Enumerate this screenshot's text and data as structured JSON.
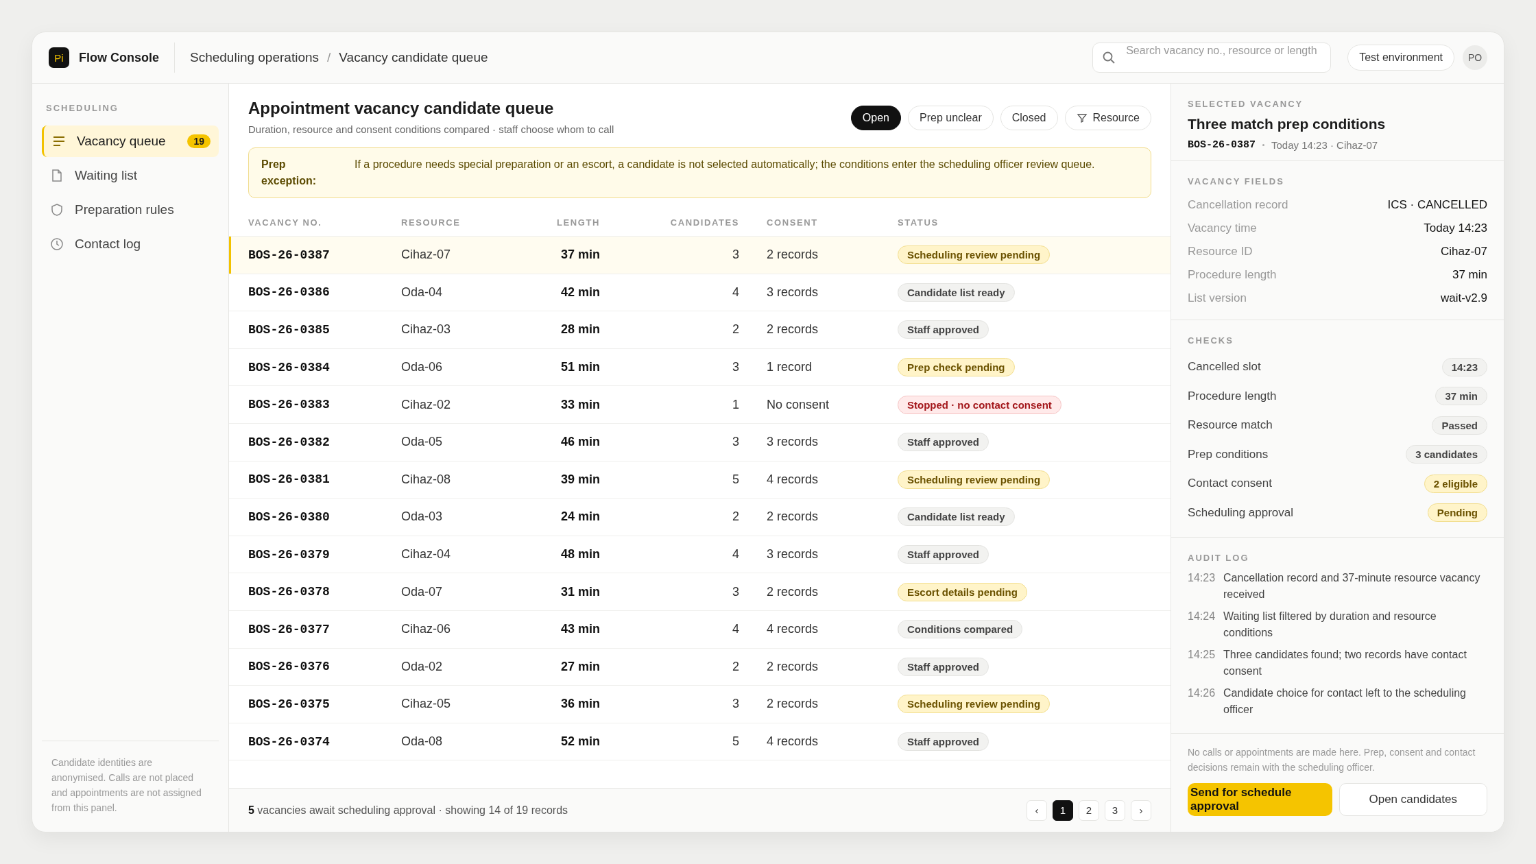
{
  "brand": {
    "logo": "Pi",
    "name": "Flow Console"
  },
  "breadcrumb": [
    "Scheduling operations",
    "/",
    "Vacancy candidate queue"
  ],
  "search": {
    "placeholder": "Search vacancy no., resource or length"
  },
  "environment": "Test environment",
  "avatar": "PO",
  "sidebar": {
    "heading": "SCHEDULING",
    "items": [
      {
        "label": "Vacancy queue",
        "badge": "19",
        "selected": true
      },
      {
        "label": "Waiting list",
        "selected": false
      },
      {
        "label": "Preparation rules",
        "selected": false
      },
      {
        "label": "Contact log",
        "selected": false
      }
    ],
    "note": "Candidate identities are anonymised. Calls are not placed and appointments are not assigned from this panel."
  },
  "main": {
    "title": "Appointment vacancy candidate queue",
    "subtitle": "Duration, resource and consent conditions compared · staff choose whom to call",
    "filters": [
      {
        "label": "Open",
        "selected": true,
        "kind": "chip"
      },
      {
        "label": "Prep unclear",
        "selected": false,
        "kind": "chip"
      },
      {
        "label": "Closed",
        "selected": false,
        "kind": "chip"
      },
      {
        "label": "Resource",
        "selected": false,
        "kind": "filter"
      }
    ],
    "banner": {
      "label": "Prep exception:",
      "text": "If a procedure needs special preparation or an escort, a candidate is not selected automatically; the conditions enter the scheduling officer review queue."
    },
    "table": {
      "columns": [
        "VACANCY NO.",
        "RESOURCE",
        "LENGTH",
        "CANDIDATES",
        "CONSENT",
        "STATUS"
      ],
      "rows": [
        {
          "id": "BOS-26-0387",
          "resource": "Cihaz-07",
          "length": "37 min",
          "candidates": "3",
          "consent": "2 records",
          "status": "Scheduling review pending",
          "kind": "warn",
          "selected": true
        },
        {
          "id": "BOS-26-0386",
          "resource": "Oda-04",
          "length": "42 min",
          "candidates": "4",
          "consent": "3 records",
          "status": "Candidate list ready",
          "kind": "neutral",
          "selected": false
        },
        {
          "id": "BOS-26-0385",
          "resource": "Cihaz-03",
          "length": "28 min",
          "candidates": "2",
          "consent": "2 records",
          "status": "Staff approved",
          "kind": "neutral",
          "selected": false
        },
        {
          "id": "BOS-26-0384",
          "resource": "Oda-06",
          "length": "51 min",
          "candidates": "3",
          "consent": "1 record",
          "status": "Prep check pending",
          "kind": "warn",
          "selected": false
        },
        {
          "id": "BOS-26-0383",
          "resource": "Cihaz-02",
          "length": "33 min",
          "candidates": "1",
          "consent": "No consent",
          "status": "Stopped · no contact consent",
          "kind": "danger",
          "selected": false
        },
        {
          "id": "BOS-26-0382",
          "resource": "Oda-05",
          "length": "46 min",
          "candidates": "3",
          "consent": "3 records",
          "status": "Staff approved",
          "kind": "neutral",
          "selected": false
        },
        {
          "id": "BOS-26-0381",
          "resource": "Cihaz-08",
          "length": "39 min",
          "candidates": "5",
          "consent": "4 records",
          "status": "Scheduling review pending",
          "kind": "warn",
          "selected": false
        },
        {
          "id": "BOS-26-0380",
          "resource": "Oda-03",
          "length": "24 min",
          "candidates": "2",
          "consent": "2 records",
          "status": "Candidate list ready",
          "kind": "neutral",
          "selected": false
        },
        {
          "id": "BOS-26-0379",
          "resource": "Cihaz-04",
          "length": "48 min",
          "candidates": "4",
          "consent": "3 records",
          "status": "Staff approved",
          "kind": "neutral",
          "selected": false
        },
        {
          "id": "BOS-26-0378",
          "resource": "Oda-07",
          "length": "31 min",
          "candidates": "3",
          "consent": "2 records",
          "status": "Escort details pending",
          "kind": "warn",
          "selected": false
        },
        {
          "id": "BOS-26-0377",
          "resource": "Cihaz-06",
          "length": "43 min",
          "candidates": "4",
          "consent": "4 records",
          "status": "Conditions compared",
          "kind": "neutral",
          "selected": false
        },
        {
          "id": "BOS-26-0376",
          "resource": "Oda-02",
          "length": "27 min",
          "candidates": "2",
          "consent": "2 records",
          "status": "Staff approved",
          "kind": "neutral",
          "selected": false
        },
        {
          "id": "BOS-26-0375",
          "resource": "Cihaz-05",
          "length": "36 min",
          "candidates": "3",
          "consent": "2 records",
          "status": "Scheduling review pending",
          "kind": "warn",
          "selected": false
        },
        {
          "id": "BOS-26-0374",
          "resource": "Oda-08",
          "length": "52 min",
          "candidates": "5",
          "consent": "4 records",
          "status": "Staff approved",
          "kind": "neutral",
          "selected": false
        }
      ]
    },
    "footer": "**5** vacancies await scheduling approval · showing 14 of 19 records",
    "pagination": {
      "prev": "‹",
      "next": "›",
      "pages": [
        {
          "label": "1",
          "selected": true
        },
        {
          "label": "2",
          "selected": false
        },
        {
          "label": "3",
          "selected": false
        }
      ]
    }
  },
  "detail": {
    "heading": "SELECTED VACANCY",
    "title": "Three match prep conditions",
    "id": "BOS-26-0387",
    "meta": "Today 14:23 · Cihaz-07",
    "fields_heading": "VACANCY FIELDS",
    "fields": [
      {
        "label": "Cancellation record",
        "value": "ICS · CANCELLED"
      },
      {
        "label": "Vacancy time",
        "value": "Today 14:23"
      },
      {
        "label": "Resource ID",
        "value": "Cihaz-07"
      },
      {
        "label": "Procedure length",
        "value": "37 min"
      },
      {
        "label": "List version",
        "value": "wait-v2.9"
      }
    ],
    "checks_heading": "CHECKS",
    "checks": [
      {
        "label": "Cancelled slot",
        "value": "14:23",
        "kind": "neutral"
      },
      {
        "label": "Procedure length",
        "value": "37 min",
        "kind": "neutral"
      },
      {
        "label": "Resource match",
        "value": "Passed",
        "kind": "neutral"
      },
      {
        "label": "Prep conditions",
        "value": "3 candidates",
        "kind": "neutral"
      },
      {
        "label": "Contact consent",
        "value": "2 eligible",
        "kind": "warn"
      },
      {
        "label": "Scheduling approval",
        "value": "Pending",
        "kind": "warn"
      }
    ],
    "log_heading": "AUDIT LOG",
    "log": [
      {
        "time": "14:23",
        "text": "Cancellation record and 37-minute resource vacancy received"
      },
      {
        "time": "14:24",
        "text": "Waiting list filtered by duration and resource conditions"
      },
      {
        "time": "14:25",
        "text": "Three candidates found; two records have contact consent"
      },
      {
        "time": "14:26",
        "text": "Candidate choice for contact left to the scheduling officer"
      }
    ],
    "note": "No calls or appointments are made here. Prep, consent and contact decisions remain with the scheduling officer.",
    "primary": "Send for schedule approval",
    "secondary": "Open candidates"
  }
}
